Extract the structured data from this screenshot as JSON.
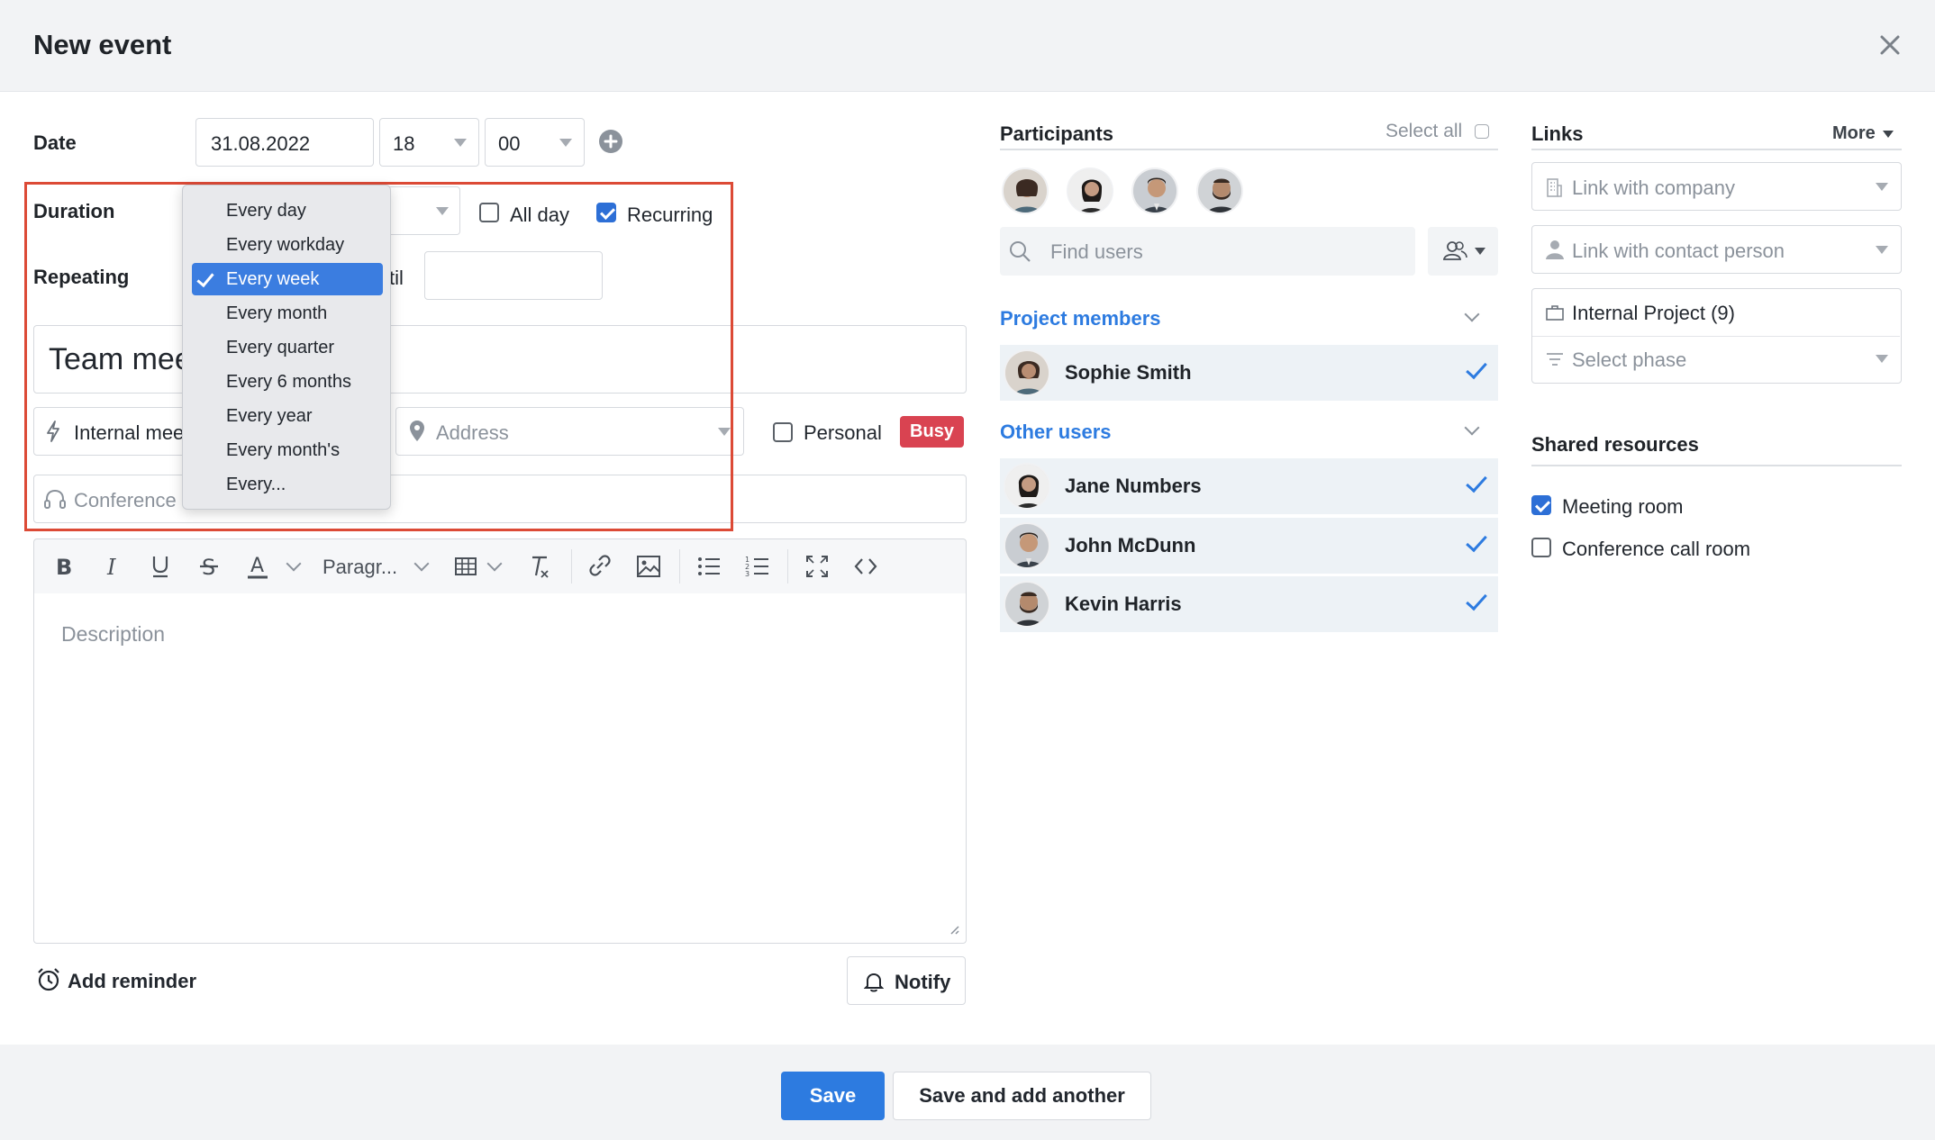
{
  "dialog": {
    "title": "New event"
  },
  "form": {
    "date_label": "Date",
    "date_value": "31.08.2022",
    "hour_value": "18",
    "minute_value": "00",
    "duration_label": "Duration",
    "all_day_label": "All day",
    "recurring_label": "Recurring",
    "repeating_label": "Repeating",
    "until_fragment": "til",
    "title_value": "Team mee",
    "category_value": "Internal mee",
    "address_placeholder": "Address",
    "personal_label": "Personal",
    "busy_badge": "Busy",
    "conference_value": "Conference",
    "description_placeholder": "Description",
    "add_reminder_label": "Add reminder",
    "notify_label": "Notify",
    "all_day_checked": false,
    "recurring_checked": true,
    "personal_checked": false
  },
  "repeat_menu": {
    "items": [
      "Every day",
      "Every workday",
      "Every week",
      "Every month",
      "Every quarter",
      "Every 6 months",
      "Every year",
      "Every month's",
      "Every..."
    ],
    "selected": "Every week"
  },
  "toolbar": {
    "paragraph_label": "Paragr...",
    "icons": [
      "bold-icon",
      "italic-icon",
      "underline-icon",
      "strikethrough-icon",
      "text-color-icon",
      "table-icon",
      "clear-format-icon",
      "link-icon",
      "image-icon",
      "bullet-list-icon",
      "numbered-list-icon",
      "fullscreen-icon",
      "code-icon"
    ]
  },
  "participants": {
    "title": "Participants",
    "select_all": "Select all",
    "find_placeholder": "Find users",
    "project_members_title": "Project members",
    "project_members": [
      {
        "name": "Sophie Smith",
        "checked": true
      }
    ],
    "other_users_title": "Other users",
    "other_users": [
      {
        "name": "Jane Numbers",
        "checked": true
      },
      {
        "name": "John McDunn",
        "checked": true
      },
      {
        "name": "Kevin Harris",
        "checked": true
      }
    ]
  },
  "links": {
    "title": "Links",
    "more_label": "More",
    "company_placeholder": "Link with company",
    "contact_placeholder": "Link with contact person",
    "project_value": "Internal Project (9)",
    "phase_placeholder": "Select phase"
  },
  "resources": {
    "title": "Shared resources",
    "items": [
      {
        "label": "Meeting room",
        "checked": true
      },
      {
        "label": "Conference call room",
        "checked": false
      }
    ]
  },
  "footer": {
    "save_label": "Save",
    "save_another_label": "Save and add another"
  },
  "colors": {
    "accent": "#2d7be0",
    "busy": "#d94351",
    "highlight_frame": "#dc4a36",
    "row_background": "#edf2f6"
  }
}
